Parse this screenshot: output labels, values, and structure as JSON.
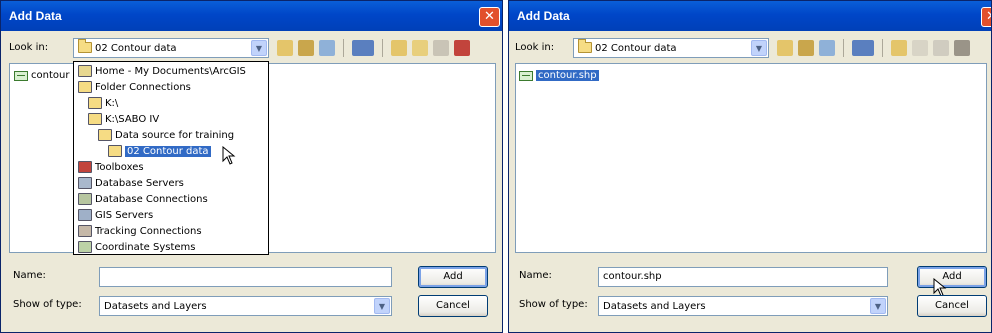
{
  "left_dialog": {
    "title": "Add Data",
    "close_label": "✕",
    "look_in_label": "Look in:",
    "look_in_value": "02 Contour data",
    "list_item": "contour",
    "dropdown_items": [
      "Home - My Documents\\ArcGIS",
      "Folder Connections",
      "K:\\",
      "K:\\SABO IV",
      "Data source for training",
      "02 Contour data",
      "Toolboxes",
      "Database Servers",
      "Database Connections",
      "GIS Servers",
      "Tracking Connections",
      "Coordinate Systems"
    ],
    "name_label": "Name:",
    "name_value": "",
    "type_label": "Show of type:",
    "type_value": "Datasets and Layers",
    "add_label": "Add",
    "cancel_label": "Cancel"
  },
  "right_dialog": {
    "title": "Add Data",
    "close_label": "✕",
    "look_in_label": "Look in:",
    "look_in_value": "02 Contour data",
    "list_item": "contour.shp",
    "name_label": "Name:",
    "name_value": "contour.shp",
    "type_label": "Show of type:",
    "type_value": "Datasets and Layers",
    "add_label": "Add",
    "cancel_label": "Cancel"
  },
  "colors": {
    "titlebar": "#0046c8",
    "selection": "#316ac5",
    "dialog_bg": "#ece9d8"
  }
}
